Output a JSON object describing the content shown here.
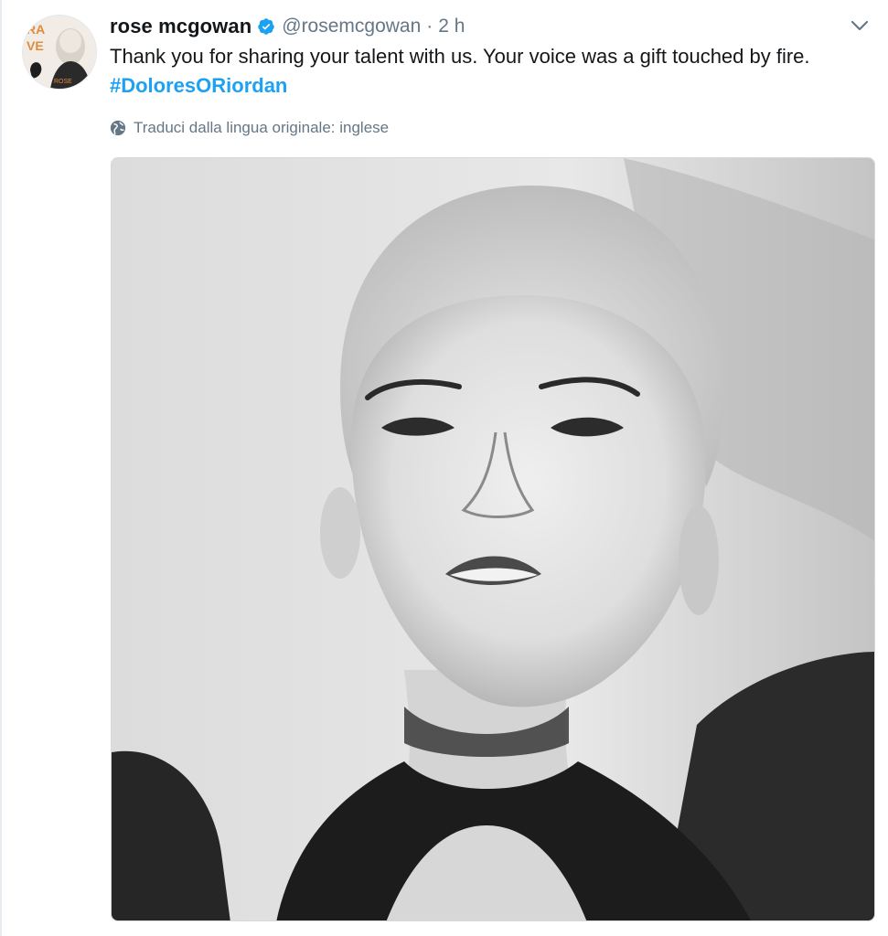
{
  "tweet": {
    "display_name": "rose mcgowan",
    "handle": "@rosemcgowan",
    "separator": "·",
    "time": "2 h",
    "text_line1": "Thank you for sharing your talent with us. Your voice was a gift touched by fire.",
    "hashtag": "#DoloresORiordan",
    "translate_label": "Traduci dalla lingua originale: inglese",
    "verified": true
  },
  "icons": {
    "verified": "verified-badge-icon",
    "caret": "chevron-down-icon",
    "globe": "globe-icon"
  },
  "colors": {
    "link": "#1da1f2",
    "secondary_text": "#657786",
    "primary_text": "#14171a"
  }
}
